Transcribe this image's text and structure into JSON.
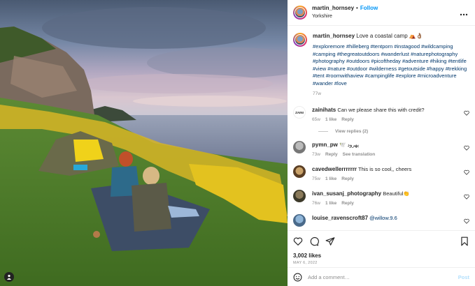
{
  "header": {
    "username": "martin_hornsey",
    "follow_label": "Follow",
    "location": "Yorkshire",
    "more_icon": "more-horizontal-icon"
  },
  "caption": {
    "username": "martin_hornsey",
    "text": "Love a coastal camp ⛺👌🏽",
    "hashtags": "#exploremore #hilleberg #tentporn #instagood #wildcamping #camping #thegreatoutdoors #wanderlust #naturephotography #photography #outdoors #picoftheday #adventure #hiking #tentlife #view #nature #outdoor #wilderness #getoutside #happy #trekking #tent #roomwithaview #campinglife #explore #microadventure #wander #love",
    "time": "77w"
  },
  "comments": [
    {
      "username": "zainihats",
      "text": "Can we please share this with credit?",
      "time": "65w",
      "likes": "1 like",
      "reply": "Reply",
      "view_replies": "View replies (2)"
    },
    {
      "username": "pymn_pw",
      "text": "🕊️ پهرود",
      "time": "73w",
      "reply": "Reply",
      "translate": "See translation"
    },
    {
      "username": "cavedwellerrrrrrr",
      "text": "This is so cool,, cheers",
      "time": "75w",
      "likes": "1 like",
      "reply": "Reply"
    },
    {
      "username": "ivan_susanj_photography",
      "text": "Beautiful👏",
      "time": "76w",
      "likes": "1 like",
      "reply": "Reply"
    },
    {
      "username": "louise_ravenscroft87",
      "text": "@willow.9.6"
    }
  ],
  "actions": {
    "likes": "3,002 likes",
    "date": "MAY 6, 2022"
  },
  "add_comment": {
    "placeholder": "Add a comment…",
    "post_label": "Post"
  },
  "colors": {
    "link": "#0095f6",
    "hashtag": "#00376b",
    "muted": "#8e8e8e"
  }
}
